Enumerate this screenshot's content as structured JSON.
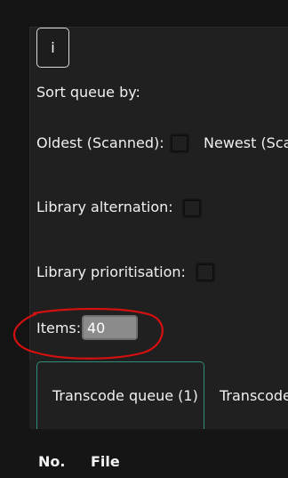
{
  "info_button": {
    "label": "i"
  },
  "sort": {
    "heading": "Sort queue by:",
    "oldest_label": "Oldest (Scanned):",
    "newest_label": "Newest (Sca",
    "library_alternation_label": "Library alternation:",
    "library_prioritisation_label": "Library prioritisation:"
  },
  "items": {
    "label": "Items:",
    "value": "40"
  },
  "tabs": [
    {
      "label": "Transcode queue (1)",
      "active": true
    },
    {
      "label": "Transcode",
      "active": false
    }
  ],
  "table": {
    "columns": [
      "No.",
      "File"
    ]
  },
  "colors": {
    "panel_bg": "#202020",
    "page_bg": "#151515",
    "active_tab_border": "#2f8f7a",
    "annotation": "#d41010"
  }
}
